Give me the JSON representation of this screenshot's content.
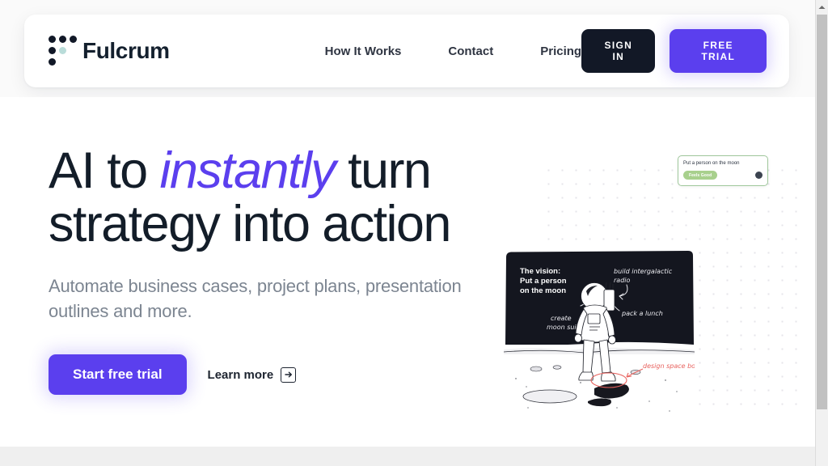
{
  "header": {
    "logo": {
      "name": "Fulcrum",
      "icon": "logo-dots-icon",
      "dot_color": "#111827",
      "accent_dot_color": "#b9dcd9"
    },
    "nav": [
      {
        "label": "How It Works"
      },
      {
        "label": "Contact"
      },
      {
        "label": "Pricing"
      }
    ],
    "sign_in_label": "SIGN IN",
    "free_trial_label": "FREE TRIAL"
  },
  "hero": {
    "headline": {
      "part1": "AI to ",
      "accent": "instantly",
      "part2": " turn strategy into action"
    },
    "subhead": "Automate business cases, project plans, presentation outlines and more.",
    "primary_cta": "Start free trial",
    "secondary_cta": "Learn more",
    "secondary_cta_icon": "arrow-right-box-icon"
  },
  "illustration": {
    "moon_card": {
      "title": "Put a person on the moon",
      "badge": "Feels Good",
      "badge_color": "#a8d08d",
      "border_color": "#9fc79b",
      "avatar": "user-avatar"
    },
    "vision_card": {
      "line1": "The vision:",
      "line2": "Put a person",
      "line3": "on the moon",
      "background": "#14161f"
    },
    "annotations": [
      {
        "text": "build intergalactic",
        "text2": "radio",
        "color": "#ffffff"
      },
      {
        "text": "pack a lunch",
        "color": "#ffffff"
      },
      {
        "text": "create",
        "text2": "moon suit",
        "color": "#ffffff"
      },
      {
        "text": "design space boots",
        "color": "#e8635f"
      }
    ]
  },
  "colors": {
    "brand_purple": "#5b3fee",
    "dark": "#121826",
    "text": "#131d29",
    "muted": "#7c8591"
  },
  "scrollbar": {
    "up_arrow": "chevron-up-icon"
  }
}
